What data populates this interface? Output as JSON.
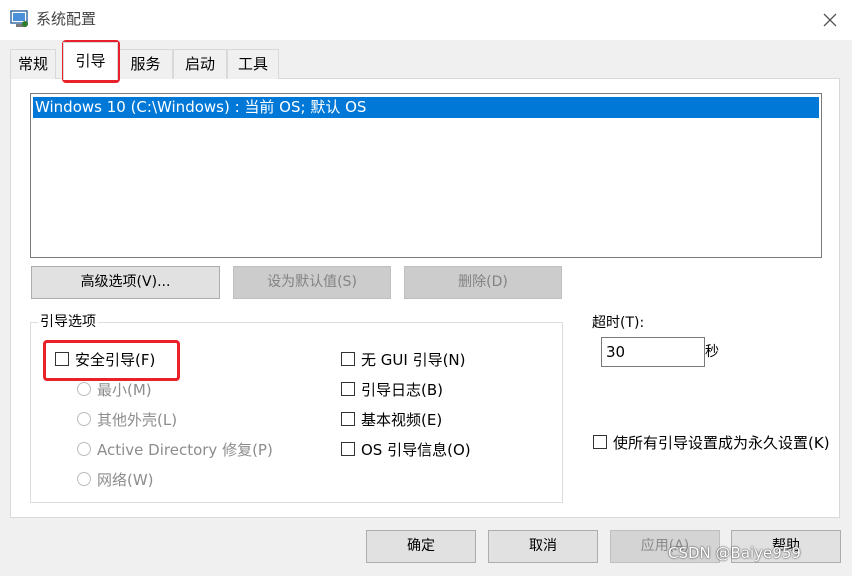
{
  "window": {
    "title": "系统配置",
    "icon": "msconfig-icon",
    "close_symbol": "✕"
  },
  "tabs": [
    {
      "label": "常规",
      "active": false
    },
    {
      "label": "引导",
      "active": true
    },
    {
      "label": "服务",
      "active": false
    },
    {
      "label": "启动",
      "active": false
    },
    {
      "label": "工具",
      "active": false
    }
  ],
  "os_list": {
    "items": [
      "Windows 10 (C:\\Windows) : 当前 OS; 默认 OS"
    ],
    "selected_index": 0
  },
  "buttons": {
    "advanced": "高级选项(V)...",
    "set_default": "设为默认值(S)",
    "delete": "删除(D)"
  },
  "boot_options": {
    "group_label": "引导选项",
    "safe_boot": {
      "label": "安全引导(F)",
      "checked": false
    },
    "radios": [
      {
        "label": "最小(M)"
      },
      {
        "label": "其他外壳(L)"
      },
      {
        "label": "Active Directory 修复(P)"
      },
      {
        "label": "网络(W)"
      }
    ],
    "checkboxes": [
      {
        "label": "无 GUI 引导(N)",
        "checked": false
      },
      {
        "label": "引导日志(B)",
        "checked": false
      },
      {
        "label": "基本视频(E)",
        "checked": false
      },
      {
        "label": "OS 引导信息(O)",
        "checked": false
      }
    ]
  },
  "timeout": {
    "label": "超时(T):",
    "value": "30",
    "unit": "秒"
  },
  "permanent": {
    "label": "使所有引导设置成为永久设置(K)",
    "checked": false
  },
  "footer": {
    "ok": "确定",
    "cancel": "取消",
    "apply": "应用(A)",
    "help": "帮助"
  },
  "watermark": "CSDN @Baiye959",
  "colors": {
    "selection": "#0078d7",
    "highlight": "#e8212a"
  }
}
